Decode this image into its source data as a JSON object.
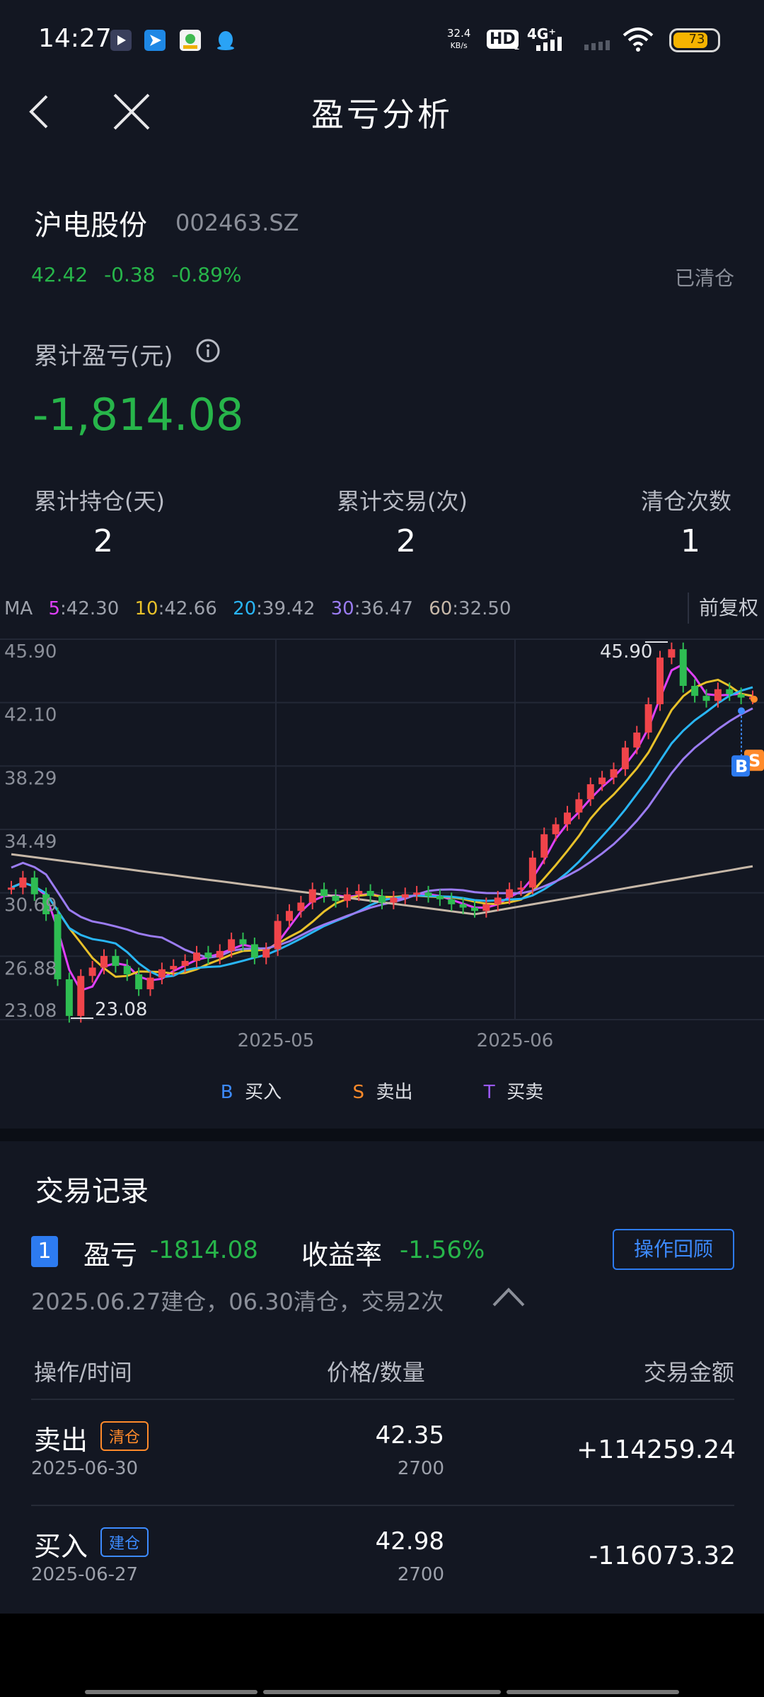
{
  "status_bar": {
    "time": "14:27",
    "net_speed_value": "32.4",
    "net_speed_unit": "KB/s",
    "hd": "HD",
    "hd_sub": "1",
    "network": "4G⁺",
    "battery": "73",
    "icons": [
      "video-app-icon",
      "send-app-icon",
      "chat-app-icon",
      "qq-icon"
    ]
  },
  "nav": {
    "title": "盈亏分析"
  },
  "stock": {
    "name": "沪电股份",
    "code": "002463.SZ",
    "price": "42.42",
    "change": "-0.38",
    "change_pct": "-0.89%",
    "status": "已清仓"
  },
  "pnl": {
    "label": "累计盈亏(元)",
    "value": "-1,814.08"
  },
  "stats": [
    {
      "label": "累计持仓(天)",
      "value": "2"
    },
    {
      "label": "累计交易(次)",
      "value": "2"
    },
    {
      "label": "清仓次数",
      "value": "1"
    }
  ],
  "ma": {
    "prefix": "MA",
    "items": [
      {
        "key": "5",
        "value": "42.30",
        "color": "#e040fb"
      },
      {
        "key": "10",
        "value": "42.66",
        "color": "#e8c12a"
      },
      {
        "key": "20",
        "value": "39.42",
        "color": "#29b6f6"
      },
      {
        "key": "30",
        "value": "36.47",
        "color": "#9b7cf2"
      },
      {
        "key": "60",
        "value": "32.50",
        "color": "#c7b8a8"
      }
    ],
    "adjust_label": "前复权"
  },
  "chart_data": {
    "type": "candlestick",
    "y_ticks": [
      "45.90",
      "42.10",
      "38.29",
      "34.49",
      "30.69",
      "26.88",
      "23.08"
    ],
    "ylim": [
      23.08,
      45.9
    ],
    "x_ticks": [
      "2025-05",
      "2025-06"
    ],
    "max_label": "45.90",
    "min_label": "23.08",
    "up_color": "#f0444a",
    "down_color": "#2ebd52",
    "markers": [
      "B",
      "S"
    ]
  },
  "legend": [
    {
      "letter": "B",
      "label": "买入",
      "color": "#3d8bff"
    },
    {
      "letter": "S",
      "label": "卖出",
      "color": "#ff8a2a"
    },
    {
      "letter": "T",
      "label": "买卖",
      "color": "#9b59ff"
    }
  ],
  "records": {
    "title": "交易记录",
    "index": "1",
    "pnl_label": "盈亏",
    "pnl_value": "-1814.08",
    "rate_label": "收益率",
    "rate_value": "-1.56%",
    "review_button": "操作回顾",
    "summary": "2025.06.27建仓，06.30清仓，交易2次",
    "headers": [
      "操作/时间",
      "价格/数量",
      "交易金额"
    ],
    "rows": [
      {
        "op": "卖出",
        "tag": "清仓",
        "tag_color": "#ff8a2a",
        "date": "2025-06-30",
        "price": "42.35",
        "qty": "2700",
        "amount": "+114259.24"
      },
      {
        "op": "买入",
        "tag": "建仓",
        "tag_color": "#3d8bff",
        "date": "2025-06-27",
        "price": "42.98",
        "qty": "2700",
        "amount": "-116073.32"
      }
    ]
  }
}
